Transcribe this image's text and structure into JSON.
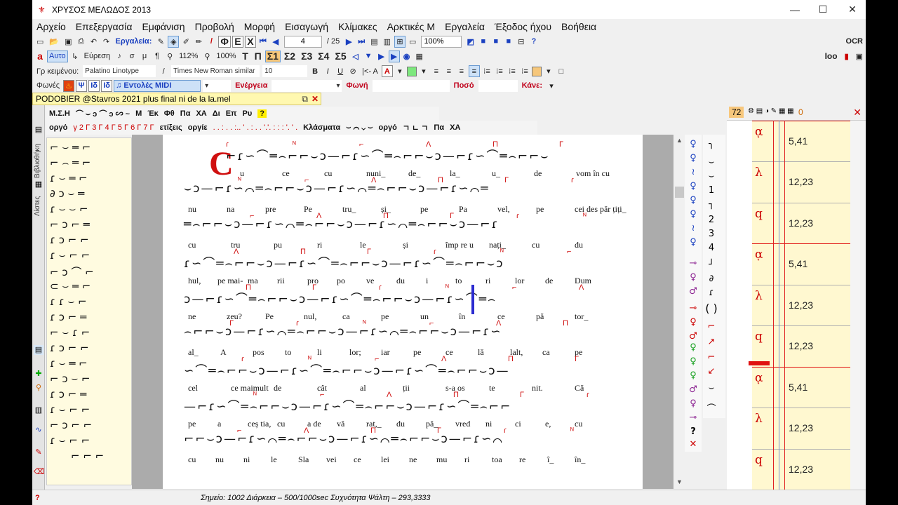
{
  "window": {
    "title": "ΧΡΥΣΟΣ ΜΕΛΩΔΟΣ 2013",
    "minimize": "—",
    "maximize": "☐",
    "close": "✕"
  },
  "menu": [
    "Αρχείο",
    "Επεξεργασία",
    "Εμφάνιση",
    "Προβολή",
    "Μορφή",
    "Εισαγωγή",
    "Κλίμακες",
    "Αρκτικές Μ",
    "Εργαλεία",
    "Έξοδος ήχου",
    "Βοήθεια"
  ],
  "toolbar1": {
    "tools_label": "Εργαλεία:",
    "letters": [
      "Φ",
      "Ε",
      "Χ"
    ],
    "page_value": "4",
    "page_total": "/ 25",
    "zoom": "100%",
    "ocr_label": "OCR"
  },
  "toolbar2": {
    "auto": "Αυτο",
    "search": "Εύρεση",
    "zoom_a": "112%",
    "zoom_b": "100%",
    "letters": [
      "Τ",
      "Π",
      "Σ1",
      "Σ2",
      "Σ3",
      "Σ4",
      "Σ5"
    ],
    "right_label": "Ιoo"
  },
  "toolbar3": {
    "text_label": "Γρ κειμένου:",
    "font1": "Palatino Linotype",
    "font2": "Times New Roman similar",
    "size": "10",
    "bold": "B",
    "italic": "I",
    "underline": "U",
    "indent_label": "|<- A"
  },
  "toolbar4": {
    "voices_label": "Φωνές",
    "psi": "Ψ",
    "midi_label": "Εντολές MIDI",
    "energy_label": "Ενέργεια",
    "voice_label": "Φωνή",
    "amount_label": "Ποσό",
    "close_label": "Κάνε:"
  },
  "document": {
    "tab": "PODOBIER @Stavros 2021 plus final ni de la la.mel",
    "close": "✕"
  },
  "glyph_toolbar1": [
    "Μ.Σ.Η",
    "Μ",
    "Έκ",
    "Φθ",
    "Πα",
    "ΧΑ",
    "Δι",
    "Επ",
    "Ρυ",
    "?"
  ],
  "glyph_toolbar2": {
    "items": [
      "οργό",
      "ετίξεις",
      "οργίε",
      "Κλάσματα",
      "οργό",
      "Πα",
      "ΧΑ"
    ],
    "numbers": "γ 2 Γ 3 Γ 4 Γ 5 Γ 6 Γ 7 Γ"
  },
  "side_tabs": {
    "lists": "Λίστες",
    "library": "Βιβλιοθήκη"
  },
  "score": {
    "initial": "C",
    "lines": [
      [
        "u",
        "ce",
        "cu",
        "nuni_",
        "de_",
        "la_",
        "u_",
        "de",
        "vom în cu"
      ],
      [
        "nu",
        "na",
        "pre",
        "Pe",
        "tru_",
        "și_",
        "pe",
        "Pa",
        "vel,",
        "pe",
        "cei des păr țiți_"
      ],
      [
        "cu",
        "tru",
        "pu",
        "ri",
        "le",
        "și",
        "împ re u",
        "nați_",
        "cu",
        "du"
      ],
      [
        "hul,",
        "pe mai-",
        "ma",
        "rii",
        "pro",
        "po",
        "ve",
        "du",
        "i",
        "to",
        "ri",
        "lor",
        "de",
        "Dum"
      ],
      [
        "ne",
        "zeu?",
        "Pe",
        "nul,",
        "ca",
        "pe",
        "un",
        "în",
        "ce",
        "pă",
        "tor_"
      ],
      [
        "al_",
        "A",
        "pos",
        "to",
        "li",
        "lor;",
        "iar",
        "pe",
        "ce",
        "lă",
        "lalt,",
        "ca",
        "pe"
      ],
      [
        "cel",
        "ce maimult",
        "de",
        "cât",
        "al",
        "ții",
        "s-a os",
        "te",
        "nit.",
        "Că"
      ],
      [
        "pe",
        "a",
        "ceș tia,",
        "cu",
        "a de",
        "vă",
        "rat,_",
        "du",
        "pă_",
        "vred",
        "ni",
        "ci",
        "e,",
        "cu"
      ],
      [
        "cu",
        "nu",
        "ni",
        "le",
        "Sla",
        "vei",
        "ce",
        "lei",
        "ne",
        "mu",
        "ri",
        "toa",
        "re",
        "î_",
        "în_"
      ]
    ]
  },
  "right_panel": {
    "number": "72",
    "close": "✕",
    "rows": [
      {
        "symbol": "ᾳ",
        "value": "5,41"
      },
      {
        "symbol": "λ",
        "value": "12,23"
      },
      {
        "symbol": "q",
        "value": "12,23"
      },
      {
        "symbol": "ᾳ",
        "value": "5,41"
      },
      {
        "symbol": "λ",
        "value": "12,23"
      },
      {
        "symbol": "q",
        "value": "12,23"
      },
      {
        "symbol": "ᾳ",
        "value": "5,41"
      },
      {
        "symbol": "λ",
        "value": "12,23"
      },
      {
        "symbol": "q",
        "value": "12,23"
      }
    ],
    "header_extra": "0"
  },
  "status": {
    "text": "Σημείο: 1002  Διάρκεια – 500/1000sec  Συχνότητα Ψάλτη – 293,3333",
    "help": "?"
  }
}
